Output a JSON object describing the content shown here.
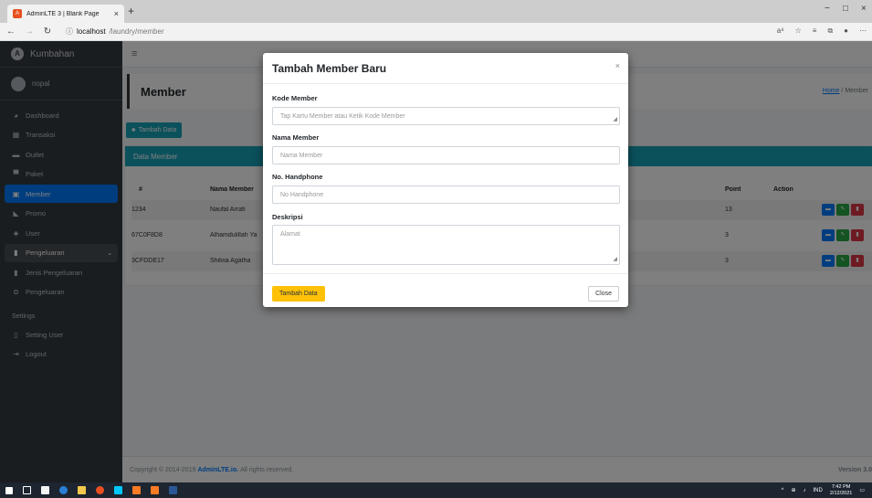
{
  "browser": {
    "tab_title": "AdminLTE 3 | Blank Page",
    "tab_close": "×",
    "new_tab": "+",
    "url_host": "localhost",
    "url_path": "/laundry/member",
    "window_controls": [
      "−",
      "□",
      "×"
    ]
  },
  "sidebar": {
    "brand": "Kumbahan",
    "user": "nopal",
    "items": [
      {
        "label": "Dashboard",
        "icon": "dashboard-icon"
      },
      {
        "label": "Transaksi",
        "icon": "cash-register-icon"
      },
      {
        "label": "Outlet",
        "icon": "store-icon"
      },
      {
        "label": "Paket",
        "icon": "box-icon"
      },
      {
        "label": "Member",
        "icon": "id-card-icon"
      },
      {
        "label": "Promo",
        "icon": "tag-icon"
      },
      {
        "label": "User",
        "icon": "users-icon"
      },
      {
        "label": "Pengeluaran",
        "icon": "file-icon"
      },
      {
        "label": "Jenis Pengeluaran",
        "icon": "file-icon"
      },
      {
        "label": "Pengeluaran",
        "icon": "money-icon"
      }
    ],
    "settings_header": "Settings",
    "settings_items": [
      {
        "label": "Setting User",
        "icon": "file-outline-icon"
      },
      {
        "label": "Logout",
        "icon": "logout-icon"
      }
    ]
  },
  "main": {
    "page_title": "Member",
    "breadcrumb_home": "Home",
    "breadcrumb_sep": " / ",
    "breadcrumb_current": "Member",
    "add_button": "Tambah Data",
    "card_title": "Data Member",
    "table": {
      "headers": [
        "#",
        "Nama Member",
        "Point",
        "Action"
      ],
      "rows": [
        {
          "id": "1234",
          "name": "Naufal Arrafi",
          "point": "13"
        },
        {
          "id": "67C0F8D8",
          "name": "Alhamdulillah Ya",
          "point": "3"
        },
        {
          "id": "3CFDDE17",
          "name": "Shilvia Agatha",
          "point": "3"
        }
      ]
    }
  },
  "footer": {
    "copyright_prefix": "Copyright © 2014-2019",
    "copyright_link": "AdminLTE.io.",
    "copyright_suffix": "All rights reserved.",
    "version": "Version 3.0"
  },
  "modal": {
    "title": "Tambah Member Baru",
    "close_icon": "×",
    "fields": {
      "kode": {
        "label": "Kode Member",
        "placeholder": "Tap Kartu Member atau Ketik Kode Member"
      },
      "nama": {
        "label": "Nama Member",
        "placeholder": "Nama Member"
      },
      "hp": {
        "label": "No. Handphone",
        "placeholder": "No Handphone"
      },
      "deskripsi": {
        "label": "Deskripsi",
        "placeholder": "Alamat"
      }
    },
    "submit": "Tambah Data",
    "close": "Close"
  },
  "taskbar": {
    "lang": "IND",
    "time": "7:42 PM",
    "date": "2/12/2021"
  },
  "colors": {
    "sidebar_bg": "#343a40",
    "active": "#007bff",
    "teal": "#17a2b8",
    "warning": "#ffc107",
    "danger": "#dc3545",
    "success": "#28a745"
  }
}
